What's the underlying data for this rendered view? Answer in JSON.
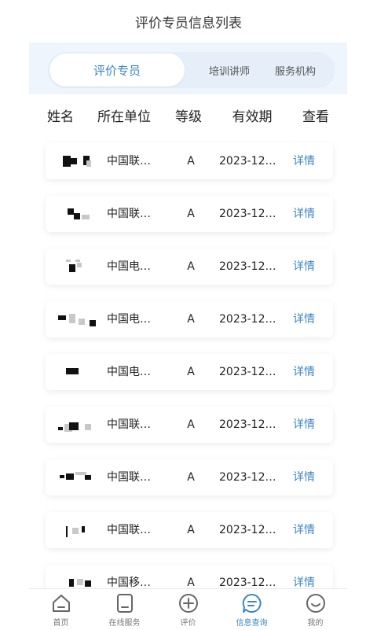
{
  "header": {
    "title": "评价专员信息列表"
  },
  "segments": [
    {
      "label": "评价专员",
      "active": true
    },
    {
      "label": "培训讲师",
      "active": false
    },
    {
      "label": "服务机构",
      "active": false
    }
  ],
  "columns": [
    "姓名",
    "所在单位",
    "等级",
    "有效期",
    "查看"
  ],
  "rows": [
    {
      "org": "中国联…",
      "level": "A",
      "date": "2023-12…",
      "link": "详情"
    },
    {
      "org": "中国联…",
      "level": "A",
      "date": "2023-12…",
      "link": "详情"
    },
    {
      "org": "中国电…",
      "level": "A",
      "date": "2023-12…",
      "link": "详情"
    },
    {
      "org": "中国电…",
      "level": "A",
      "date": "2023-12…",
      "link": "详情"
    },
    {
      "org": "中国电…",
      "level": "A",
      "date": "2023-12…",
      "link": "详情"
    },
    {
      "org": "中国联…",
      "level": "A",
      "date": "2023-12…",
      "link": "详情"
    },
    {
      "org": "中国联…",
      "level": "A",
      "date": "2023-12…",
      "link": "详情"
    },
    {
      "org": "中国联…",
      "level": "A",
      "date": "2023-12…",
      "link": "详情"
    },
    {
      "org": "中国移…",
      "level": "A",
      "date": "2023-12…",
      "link": "详情"
    }
  ],
  "tabbar": [
    {
      "label": "首页",
      "icon": "home-icon"
    },
    {
      "label": "在线服务",
      "icon": "document-icon"
    },
    {
      "label": "评价",
      "icon": "plus-circle-icon"
    },
    {
      "label": "信息查询",
      "icon": "chat-bubble-icon",
      "active": true
    },
    {
      "label": "我的",
      "icon": "smiley-icon"
    }
  ],
  "colors": {
    "accent": "#3d86c6",
    "segment_bg": "#eef5fc",
    "text": "#222222"
  }
}
